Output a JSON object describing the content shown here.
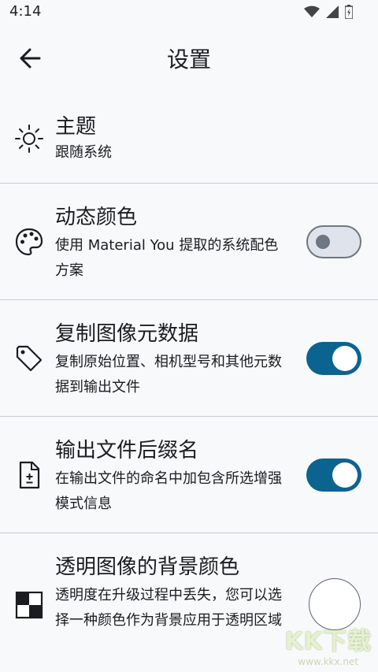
{
  "status_bar": {
    "time": "4:14"
  },
  "header": {
    "title": "设置"
  },
  "settings": [
    {
      "title": "主题",
      "subtitle": "跟随系统"
    },
    {
      "title": "动态颜色",
      "subtitle": "使用 Material You 提取的系统配色方案",
      "switch_on": false
    },
    {
      "title": "复制图像元数据",
      "subtitle": "复制原始位置、相机型号和其他元数据到输出文件",
      "switch_on": true
    },
    {
      "title": "输出文件后缀名",
      "subtitle": "在输出文件的命名中加包含所选增强模式信息",
      "switch_on": true
    },
    {
      "title": "透明图像的背景颜色",
      "subtitle": "透明度在升级过程中丢失，您可以选择一种颜色作为背景应用于透明区域",
      "color": "#ffffff"
    }
  ],
  "watermark": {
    "text": "KK下载",
    "url": "www.kkx.net"
  },
  "colors": {
    "accent": "#0b6390",
    "switch_off_track": "#dfe3eb",
    "switch_off_border": "#6f7782",
    "divider": "#c9cbd0"
  }
}
